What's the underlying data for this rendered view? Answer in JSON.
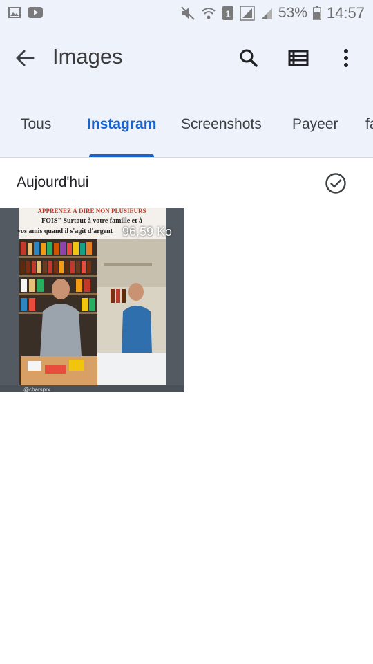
{
  "status_bar": {
    "battery": "53%",
    "time": "14:57",
    "sim_slot": "1"
  },
  "app_bar": {
    "title": "Images"
  },
  "tabs": [
    {
      "label": "Tous",
      "active": false
    },
    {
      "label": "Instagram",
      "active": true
    },
    {
      "label": "Screenshots",
      "active": false
    },
    {
      "label": "Payeer",
      "active": false
    },
    {
      "label": "fa",
      "active": false
    }
  ],
  "section": {
    "title": "Aujourd'hui"
  },
  "thumbnail": {
    "size_label": "96,59 Ko",
    "caption_line1": "APPRENEZ À DIRE NON PLUSIEURS",
    "caption_line2": "FOIS\" Surtout à votre famille et à",
    "caption_line3": "vos amis quand il s'agit d'argent",
    "watermark": "@charsprx"
  },
  "colors": {
    "accent": "#1a62d0",
    "bar_background": "#eef2fb"
  }
}
